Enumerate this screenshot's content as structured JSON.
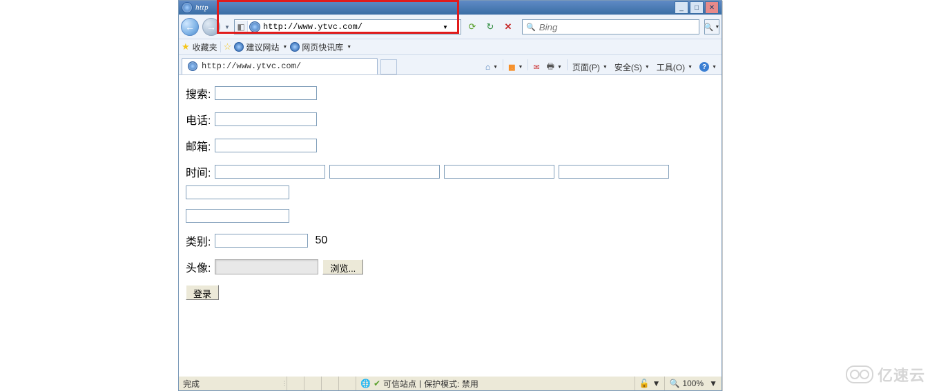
{
  "window": {
    "title_prefix": "http",
    "min": "_",
    "max": "□",
    "close": "✕"
  },
  "addressbar": {
    "url": "http://www.ytvc.com/"
  },
  "searchbox": {
    "placeholder": "Bing"
  },
  "favbar": {
    "favorites_label": "收藏夹",
    "suggested_sites": "建议网站",
    "web_slice": "网页快讯库"
  },
  "tabs": {
    "active_title": "http://www.ytvc.com/"
  },
  "commandbar": {
    "page": "页面(P)",
    "safety": "安全(S)",
    "tools": "工具(O)"
  },
  "form": {
    "labels": {
      "search": "搜索:",
      "phone": "电话:",
      "email": "邮箱:",
      "time": "时间:",
      "category": "类别:",
      "avatar": "头像:"
    },
    "range_output": "50",
    "browse_button": "浏览...",
    "submit_button": "登录"
  },
  "statusbar": {
    "done": "完成",
    "trusted": "可信站点",
    "protected_mode": "保护模式: 禁用",
    "zoom": "100%"
  },
  "watermark": "亿速云"
}
